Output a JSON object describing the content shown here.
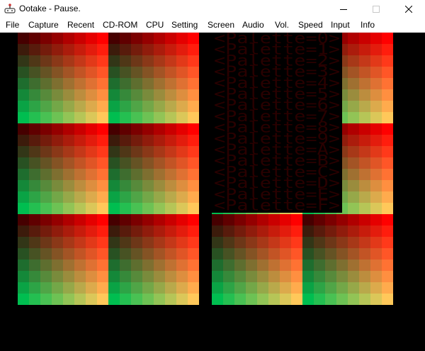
{
  "window": {
    "title": "Ootake - Pause.",
    "icon": "joystick-icon",
    "controls": [
      "minimize-icon",
      "maximize-icon",
      "close-icon"
    ]
  },
  "menu": {
    "items": [
      "File",
      "Capture",
      "Recent",
      "CD-ROM",
      "CPU",
      "Setting",
      "Screen",
      "Audio",
      "Vol.",
      "Speed",
      "Input",
      "Info"
    ]
  },
  "screen": {
    "background": "#000000",
    "text_color": "#2a0000",
    "palette_lines": [
      "<Palette=0>",
      "<Palette=1>",
      "<Palette=2>",
      "<Palette=3>",
      "<Palette=4>",
      "<Palette=5>",
      "<Palette=6>",
      "<Palette=7>",
      "<Palette=8>",
      "<Palette=9>",
      "<Palette=A>",
      "<Palette=B>",
      "<Palette=C>",
      "<Palette=D>",
      "<Palette=E>",
      "<Palette=F>"
    ]
  }
}
